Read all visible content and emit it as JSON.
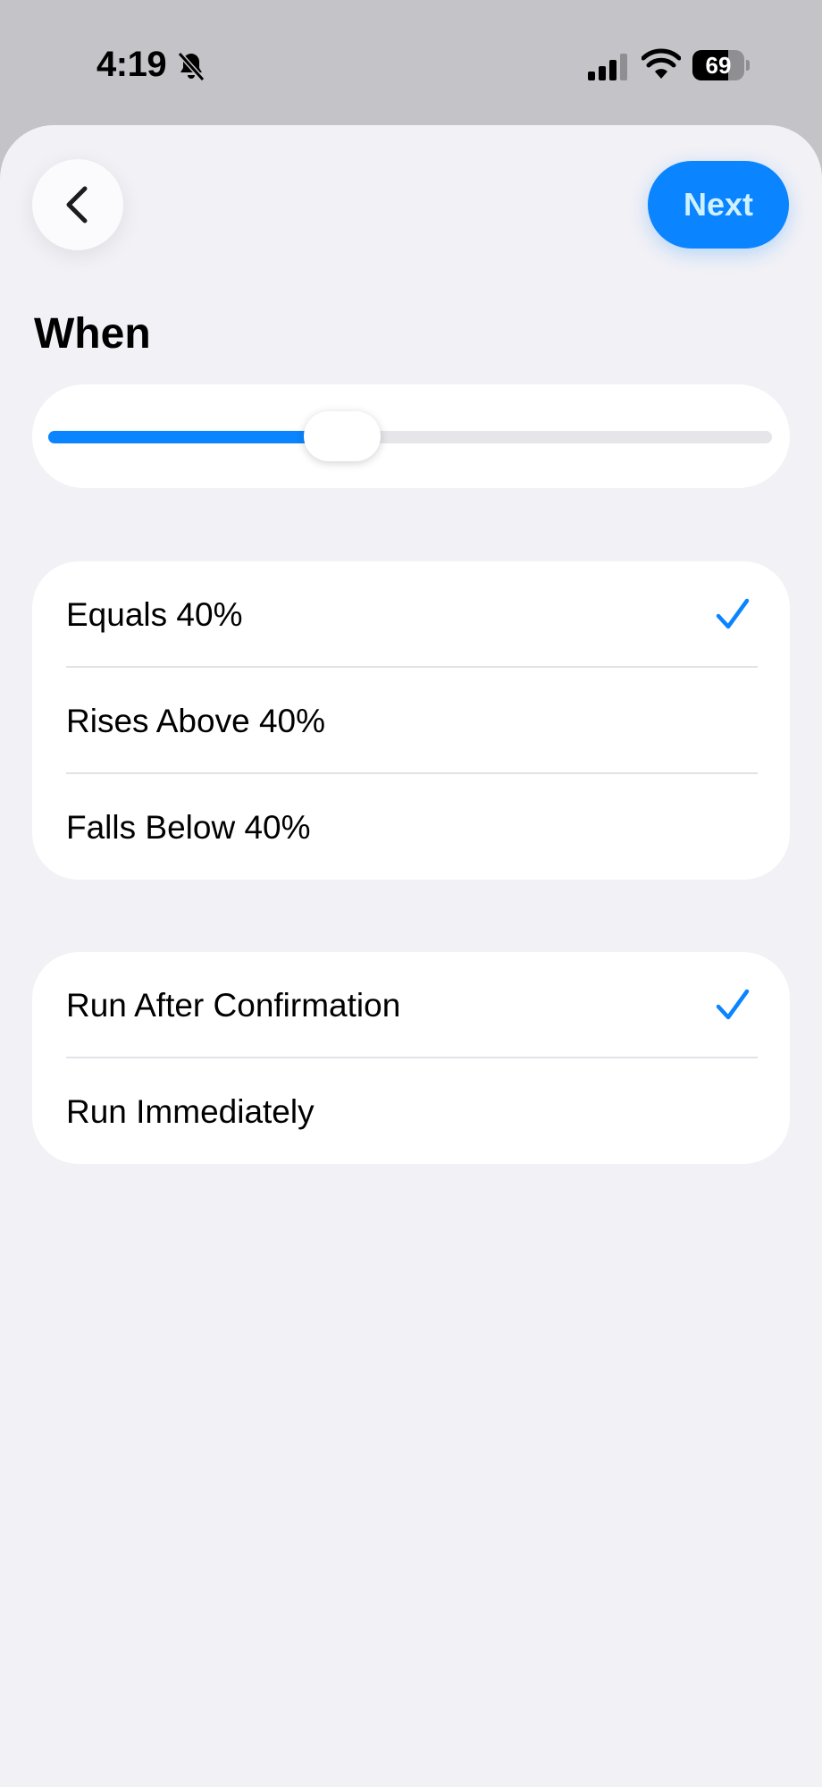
{
  "status_bar": {
    "time": "4:19",
    "battery_level": "69",
    "icons": [
      "bell-slash-icon",
      "cellular-signal-icon",
      "wifi-icon",
      "battery-icon"
    ]
  },
  "nav": {
    "back_icon": "chevron-left-icon",
    "next_label": "Next"
  },
  "section": {
    "title": "When"
  },
  "slider": {
    "value_fraction": 0.4
  },
  "condition_options": [
    {
      "label": "Equals 40%",
      "selected": true
    },
    {
      "label": "Rises Above 40%",
      "selected": false
    },
    {
      "label": "Falls Below 40%",
      "selected": false
    }
  ],
  "run_options": [
    {
      "label": "Run After Confirmation",
      "selected": true
    },
    {
      "label": "Run Immediately",
      "selected": false
    }
  ],
  "colors": {
    "accent": "#0a84ff",
    "background": "#f1f1f6",
    "card": "#ffffff"
  }
}
